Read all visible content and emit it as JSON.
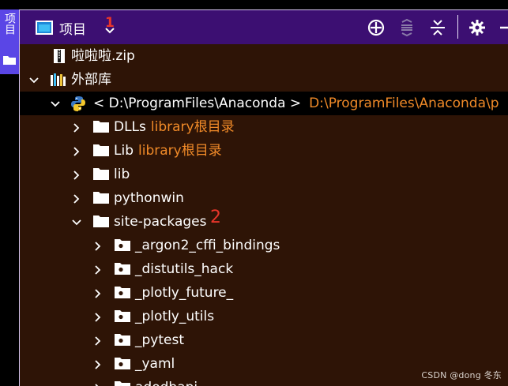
{
  "side": {
    "label": "项目"
  },
  "header": {
    "title": "项目",
    "annotation": "1",
    "icons": [
      "locate-icon",
      "expand-all-icon",
      "collapse-all-icon",
      "settings-icon",
      "minimize-icon"
    ]
  },
  "tree": {
    "rows": [
      {
        "label": "啦啦啦.zip",
        "sub": ""
      },
      {
        "label": "外部库",
        "sub": ""
      },
      {
        "label": "< D:\\ProgramFiles\\Anaconda >",
        "sub": "D:\\ProgramFiles\\Anaconda\\p"
      },
      {
        "label": "DLLs",
        "sub": "library根目录"
      },
      {
        "label": "Lib",
        "sub": "library根目录"
      },
      {
        "label": "lib",
        "sub": ""
      },
      {
        "label": "pythonwin",
        "sub": ""
      },
      {
        "label": "site-packages",
        "sub": "",
        "annotation": "2"
      },
      {
        "label": "_argon2_cffi_bindings",
        "sub": ""
      },
      {
        "label": "_distutils_hack",
        "sub": ""
      },
      {
        "label": "_plotly_future_",
        "sub": ""
      },
      {
        "label": "_plotly_utils",
        "sub": ""
      },
      {
        "label": "_pytest",
        "sub": ""
      },
      {
        "label": "_yaml",
        "sub": ""
      },
      {
        "label": "adodbapi",
        "sub": ""
      }
    ]
  },
  "watermark": "CSDN @dong 冬东",
  "colors": {
    "header_bg": "#3c0f72",
    "tree_bg": "#2e1406",
    "selected_bg": "#000000",
    "accent_orange": "#f08a28",
    "annotation_red": "#e8352a",
    "side_tab": "#5a46e6"
  }
}
